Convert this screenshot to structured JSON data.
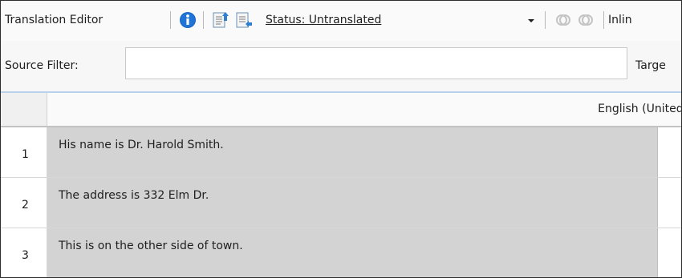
{
  "toolbar": {
    "title": "Translation Editor",
    "info_icon": "info-icon",
    "export_icon": "export-document-icon",
    "import_icon": "import-document-icon",
    "status_label": "Status: Untranslated",
    "dropdown_icon": "dropdown-arrow-icon",
    "toggle_icon_1": "toggle-icon",
    "toggle_icon_2": "toggle-icon",
    "inline_label": "Inlin"
  },
  "filter": {
    "source_label": "Source Filter:",
    "source_value": "",
    "target_label": "Targe"
  },
  "grid": {
    "column_header": "English (United Sta",
    "rows": [
      {
        "num": "1",
        "text": "His name is Dr. Harold Smith."
      },
      {
        "num": "2",
        "text": "The address is 332 Elm Dr."
      },
      {
        "num": "3",
        "text": "This is on the other side of town."
      }
    ]
  },
  "colors": {
    "cell_background": "#d3d3d3",
    "filter_border_accent": "#b9d1ea",
    "info_blue": "#1565c0"
  }
}
